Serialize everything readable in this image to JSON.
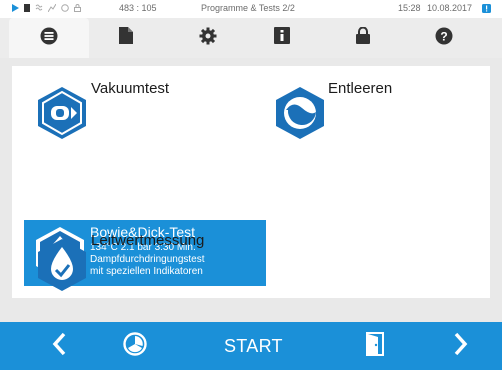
{
  "status": {
    "coordinates": "483 : 105",
    "screen_title": "Programme & Tests  2/2",
    "time": "15:28",
    "date": "10.08.2017"
  },
  "tabs": [
    {
      "icon": "menu-list-icon",
      "active": true
    },
    {
      "icon": "document-icon",
      "active": false
    },
    {
      "icon": "gear-icon",
      "active": false
    },
    {
      "icon": "info-book-icon",
      "active": false
    },
    {
      "icon": "lock-icon",
      "active": false
    },
    {
      "icon": "help-icon",
      "active": false
    }
  ],
  "programs": {
    "vakuumtest": {
      "label": "Vakuumtest",
      "icon": "vacuum-test-icon"
    },
    "entleeren": {
      "label": "Entleeren",
      "icon": "drain-icon"
    },
    "bowie": {
      "label": "Bowie&Dick-Test",
      "params": "134°C   2.1 bar   3:30 Min.",
      "desc_line1": "Dampfdurchdringungstest",
      "desc_line2": "mit speziellen Indikatoren",
      "icon": "bowie-dick-icon",
      "selected": true
    },
    "leitwert": {
      "label": "Leitwertmessung",
      "icon": "conductivity-icon"
    }
  },
  "bottom": {
    "start_label": "START",
    "prev_icon": "chevron-left-icon",
    "timer_icon": "timer-icon",
    "door_icon": "door-icon",
    "next_icon": "chevron-right-icon"
  },
  "colors": {
    "accent": "#1b90d8",
    "icon_blue": "#1b70b8",
    "tab_icon": "#333333",
    "alert": "#1b90d8"
  }
}
